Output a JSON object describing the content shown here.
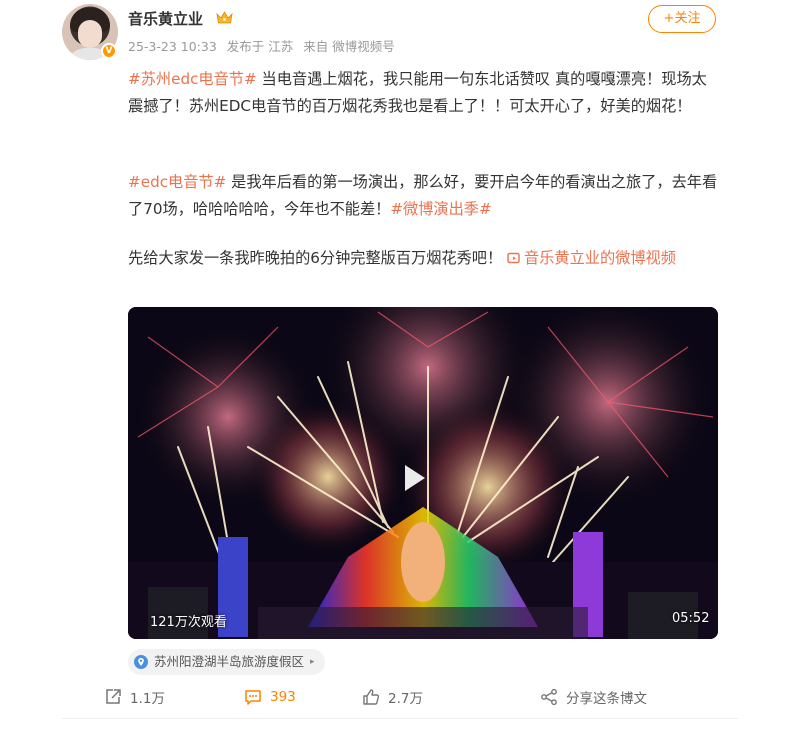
{
  "post": {
    "author": "音乐黄立业",
    "verified_badge": "V",
    "meta": {
      "time": "25-3-23 10:33",
      "posted_at": "发布于 江苏",
      "source": "来自 微博视频号"
    },
    "follow_label": "+关注",
    "text": {
      "p1_tag": "#苏州edc电音节#",
      "p1_body": " 当电音遇上烟花，我只能用一句东北话赞叹 真的嘎嘎漂亮！现场太震撼了！苏州EDC电音节的百万烟花秀我也是看上了！！可太开心了，好美的烟花！",
      "p2_tag": "#edc电音节#",
      "p2_body": " 是我年后看的第一场演出，那么好，要开启今年的看演出之旅了，去年看了70场，哈哈哈哈哈，今年也不能差！",
      "p2_tag2": "#微博演出季#",
      "p3_body": "先给大家发一条我昨晚拍的6分钟完整版百万烟花秀吧！ ",
      "p3_link": "音乐黄立业的微博视频"
    },
    "video": {
      "views": "121万次观看",
      "duration": "05:52"
    },
    "location": "苏州阳澄湖半岛旅游度假区",
    "actions": {
      "share_count": "1.1万",
      "comment_count": "393",
      "like_count": "2.7万",
      "forward_label": "分享这条博文"
    }
  },
  "colors": {
    "accent": "#ff8200",
    "topic": "#eb7350",
    "meta_gray": "#999999"
  },
  "icons": {
    "crown": "crown-icon",
    "play": "play-icon",
    "pin": "location-pin-icon",
    "share": "share-icon",
    "comment": "comment-icon",
    "like": "thumbs-up-icon",
    "forward": "forward-share-icon",
    "video_link": "video-link-icon"
  }
}
